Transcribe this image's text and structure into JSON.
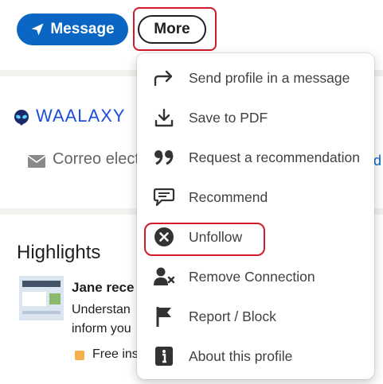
{
  "actions": {
    "message_label": "Message",
    "more_label": "More"
  },
  "profile": {
    "company": "WAALAXY",
    "email_label": "Correo elect",
    "link_fragment": "rd"
  },
  "highlights": {
    "title": "Highlights",
    "item_title": "Jane rece",
    "item_line1": "Understan",
    "item_line2": "inform you",
    "item_free": "Free ins"
  },
  "menu": {
    "items": [
      {
        "label": "Send profile in a message",
        "icon": "share-arrow-icon"
      },
      {
        "label": "Save to PDF",
        "icon": "download-icon"
      },
      {
        "label": "Request a recommendation",
        "icon": "quote-icon"
      },
      {
        "label": "Recommend",
        "icon": "speech-bubble-icon"
      },
      {
        "label": "Unfollow",
        "icon": "close-circle-icon"
      },
      {
        "label": "Remove Connection",
        "icon": "remove-person-icon"
      },
      {
        "label": "Report / Block",
        "icon": "flag-icon"
      },
      {
        "label": "About this profile",
        "icon": "info-icon"
      }
    ]
  },
  "colors": {
    "primary": "#0a66c2",
    "highlight_outline": "#d11a2a",
    "brand_waalaxy": "#1c4fd8"
  }
}
